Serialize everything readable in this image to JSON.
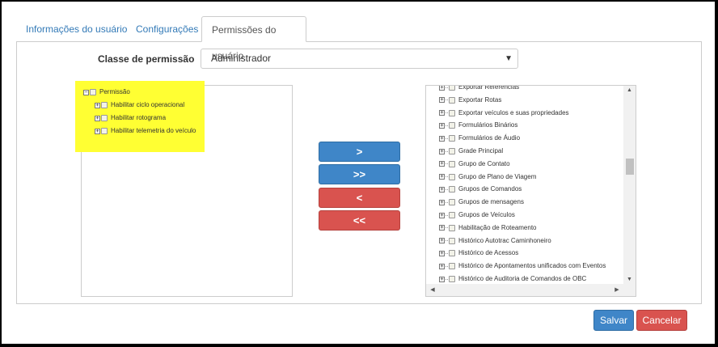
{
  "tabs": [
    {
      "label": "Informações do usuário"
    },
    {
      "label": "Configurações"
    },
    {
      "label": "Permissões do usuário"
    }
  ],
  "permission_class": {
    "label": "Classe de permissão",
    "selected": "Administrador"
  },
  "left_tree": {
    "root": "Permissão",
    "children": [
      "Habilitar ciclo operacional",
      "Habilitar rotograma",
      "Habilitar telemetria do veículo"
    ]
  },
  "transfer_buttons": {
    "move_right": ">",
    "move_all_right": ">>",
    "move_left": "<",
    "move_all_left": "<<"
  },
  "right_tree": {
    "items": [
      "Exportar Referências",
      "Exportar Rotas",
      "Exportar veículos e suas propriedades",
      "Formulários Binários",
      "Formulários de Áudio",
      "Grade Principal",
      "Grupo de Contato",
      "Grupo de Plano de Viagem",
      "Grupos de Comandos",
      "Grupos de mensagens",
      "Grupos de Veículos",
      "Habilitação de Roteamento",
      "Histórico Autotrac Caminhoneiro",
      "Histórico de Acessos",
      "Histórico de Apontamentos unificados com Eventos",
      "Histórico de Auditoria de Comandos de OBC"
    ]
  },
  "footer": {
    "save_label": "Salvar",
    "cancel_label": "Cancelar"
  },
  "colors": {
    "primary": "#3f86c8",
    "danger": "#d9534f",
    "highlight": "#ffff33",
    "link": "#337ab7"
  }
}
